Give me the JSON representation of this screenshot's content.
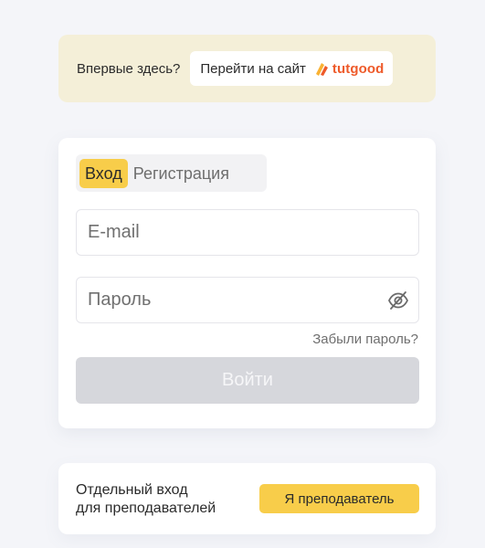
{
  "promo": {
    "question": "Впервые здесь?",
    "site_button_label": "Перейти на сайт",
    "brand_name": "tutgood",
    "brand_color": "#ee5a2a"
  },
  "auth": {
    "tabs": [
      {
        "label": "Вход",
        "active": true
      },
      {
        "label": "Регистрация",
        "active": false
      }
    ],
    "email": {
      "value": "",
      "placeholder": "E-mail"
    },
    "password": {
      "value": "",
      "placeholder": "Пароль",
      "toggle_icon": "eye-off-icon"
    },
    "forgot_label": "Забыли пароль?",
    "submit_label": "Войти"
  },
  "teacher": {
    "line1": "Отдельный вход",
    "line2": "для преподавателей",
    "button_label": "Я преподаватель"
  },
  "colors": {
    "accent": "#f8cd4a",
    "promo_background": "#f4efd8",
    "disabled_button": "#d6d7dc",
    "page_background": "#f4f5f9"
  }
}
